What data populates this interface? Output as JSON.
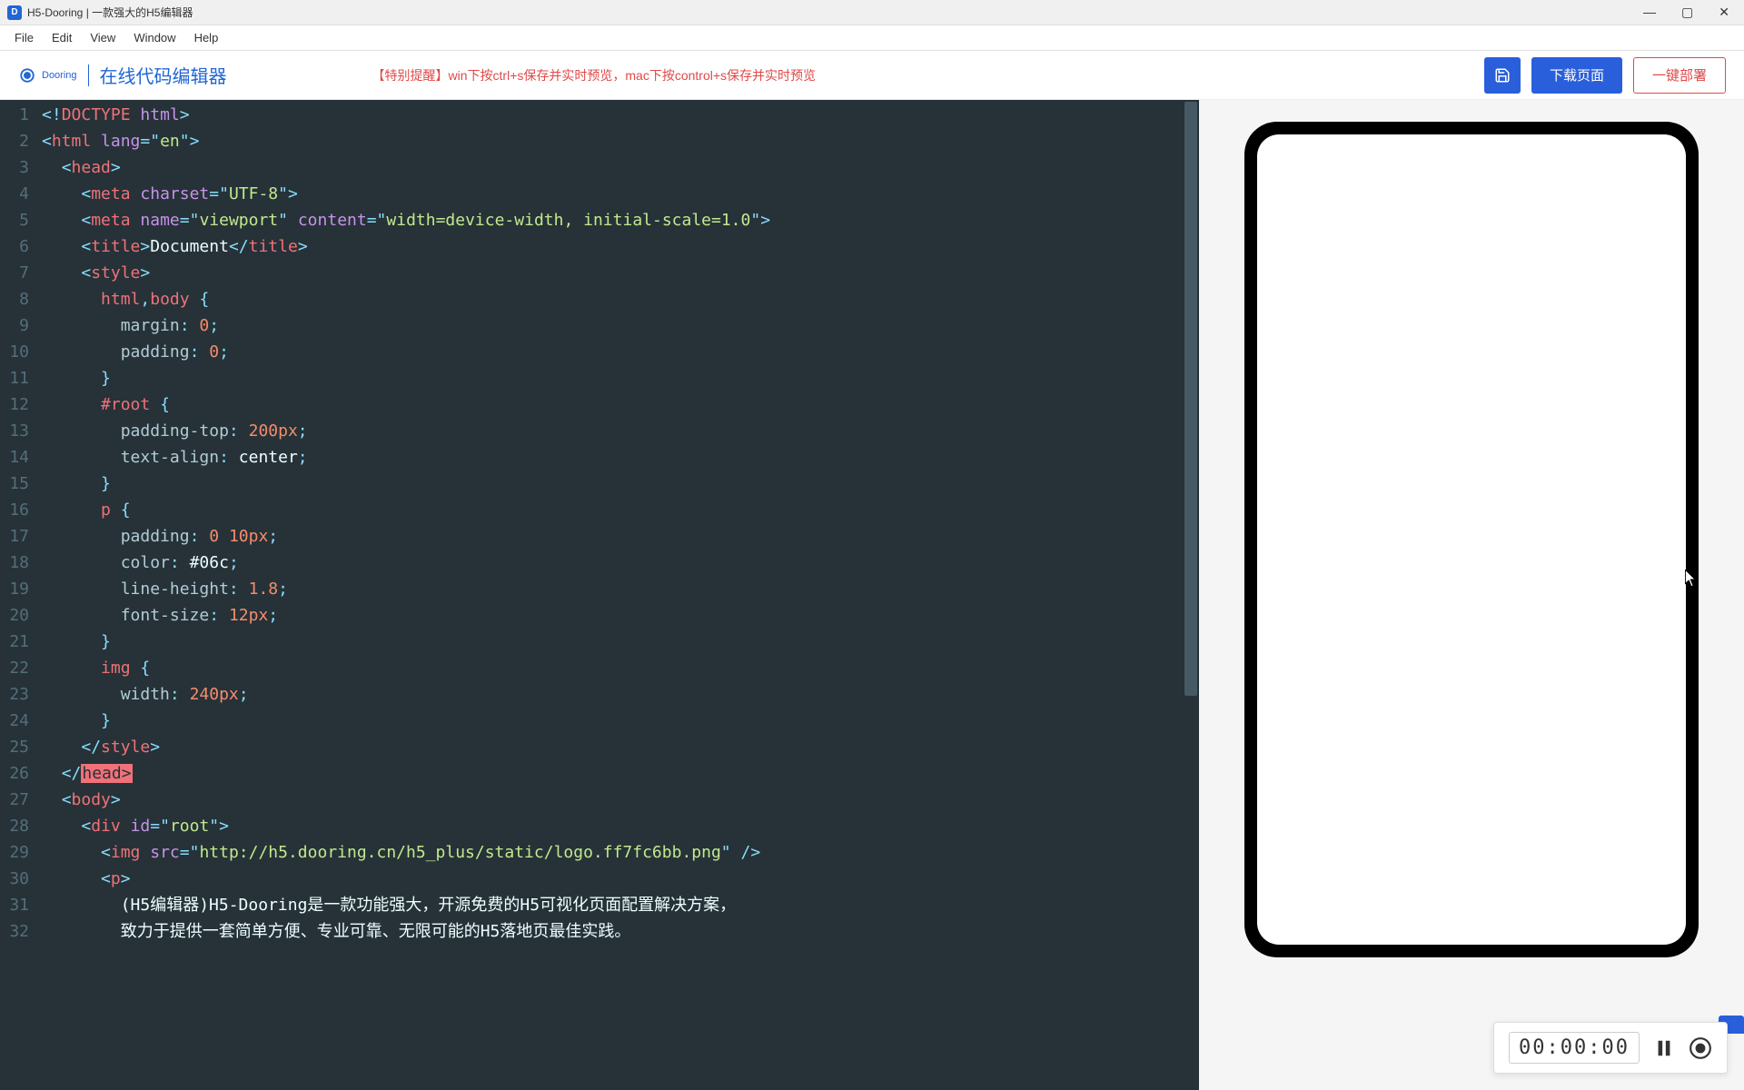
{
  "window": {
    "title": "H5-Dooring | 一款强大的H5编辑器"
  },
  "menu": {
    "file": "File",
    "edit": "Edit",
    "view": "View",
    "window": "Window",
    "help": "Help"
  },
  "toolbar": {
    "logo_text": "Dooring",
    "page_title": "在线代码编辑器",
    "tip_label": "【特别提醒】",
    "tip_text": "win下按ctrl+s保存并实时预览，mac下按control+s保存并实时预览",
    "download_label": "下载页面",
    "deploy_label": "一键部署"
  },
  "recorder": {
    "timer": "00:00:00"
  },
  "code": {
    "lines": [
      {
        "n": 1,
        "html": "<span class='c-punc'>&lt;!</span><span class='c-tag'>DOCTYPE</span> <span class='c-attr'>html</span><span class='c-punc'>&gt;</span>"
      },
      {
        "n": 2,
        "html": "<span class='c-punc'>&lt;</span><span class='c-tag'>html</span> <span class='c-attr'>lang</span><span class='c-punc'>=</span><span class='c-punc'>\"</span><span class='c-str'>en</span><span class='c-punc'>\"</span><span class='c-punc'>&gt;</span>"
      },
      {
        "n": 3,
        "html": "  <span class='c-punc'>&lt;</span><span class='c-tag'>head</span><span class='c-punc'>&gt;</span>"
      },
      {
        "n": 4,
        "html": "    <span class='c-punc'>&lt;</span><span class='c-tag'>meta</span> <span class='c-attr'>charset</span><span class='c-punc'>=</span><span class='c-punc'>\"</span><span class='c-str'>UTF-8</span><span class='c-punc'>\"</span><span class='c-punc'>&gt;</span>"
      },
      {
        "n": 5,
        "html": "    <span class='c-punc'>&lt;</span><span class='c-tag'>meta</span> <span class='c-attr'>name</span><span class='c-punc'>=</span><span class='c-punc'>\"</span><span class='c-str'>viewport</span><span class='c-punc'>\"</span> <span class='c-attr'>content</span><span class='c-punc'>=</span><span class='c-punc'>\"</span><span class='c-str'>width=device-width, initial-scale=1.0</span><span class='c-punc'>\"</span><span class='c-punc'>&gt;</span>"
      },
      {
        "n": 6,
        "html": "    <span class='c-punc'>&lt;</span><span class='c-tag'>title</span><span class='c-punc'>&gt;</span><span class='c-text'>Document</span><span class='c-punc'>&lt;/</span><span class='c-tag'>title</span><span class='c-punc'>&gt;</span>"
      },
      {
        "n": 7,
        "html": "    <span class='c-punc'>&lt;</span><span class='c-tag'>style</span><span class='c-punc'>&gt;</span>"
      },
      {
        "n": 8,
        "html": "      <span class='c-tag'>html</span><span class='c-punc'>,</span><span class='c-tag'>body</span> <span class='c-punc'>{</span>"
      },
      {
        "n": 9,
        "html": "        <span class='c-prop'>margin</span><span class='c-punc'>:</span> <span class='c-num'>0</span><span class='c-punc'>;</span>"
      },
      {
        "n": 10,
        "html": "        <span class='c-prop'>padding</span><span class='c-punc'>:</span> <span class='c-num'>0</span><span class='c-punc'>;</span>"
      },
      {
        "n": 11,
        "html": "      <span class='c-punc'>}</span>"
      },
      {
        "n": 12,
        "html": "      <span class='c-tag'>#root</span> <span class='c-punc'>{</span>"
      },
      {
        "n": 13,
        "html": "        <span class='c-prop'>padding-top</span><span class='c-punc'>:</span> <span class='c-num'>200px</span><span class='c-punc'>;</span>"
      },
      {
        "n": 14,
        "html": "        <span class='c-prop'>text-align</span><span class='c-punc'>:</span> <span class='c-text'>center</span><span class='c-punc'>;</span>"
      },
      {
        "n": 15,
        "html": "      <span class='c-punc'>}</span>"
      },
      {
        "n": 16,
        "html": "      <span class='c-tag'>p</span> <span class='c-punc'>{</span>"
      },
      {
        "n": 17,
        "html": "        <span class='c-prop'>padding</span><span class='c-punc'>:</span> <span class='c-num'>0</span> <span class='c-num'>10px</span><span class='c-punc'>;</span>"
      },
      {
        "n": 18,
        "html": "        <span class='c-prop'>color</span><span class='c-punc'>:</span> <span class='c-text'>#06c</span><span class='c-punc'>;</span>"
      },
      {
        "n": 19,
        "html": "        <span class='c-prop'>line-height</span><span class='c-punc'>:</span> <span class='c-num'>1.8</span><span class='c-punc'>;</span>"
      },
      {
        "n": 20,
        "html": "        <span class='c-prop'>font-size</span><span class='c-punc'>:</span> <span class='c-num'>12px</span><span class='c-punc'>;</span>"
      },
      {
        "n": 21,
        "html": "      <span class='c-punc'>}</span>"
      },
      {
        "n": 22,
        "html": "      <span class='c-tag'>img</span> <span class='c-punc'>{</span>"
      },
      {
        "n": 23,
        "html": "        <span class='c-prop'>width</span><span class='c-punc'>:</span> <span class='c-num'>240px</span><span class='c-punc'>;</span>"
      },
      {
        "n": 24,
        "html": "      <span class='c-punc'>}</span>"
      },
      {
        "n": 25,
        "html": "    <span class='c-punc'>&lt;/</span><span class='c-tag'>style</span><span class='c-punc'>&gt;</span>"
      },
      {
        "n": 26,
        "html": "  <span class='c-punc'>&lt;/</span><span class='hl'>head&gt;</span>"
      },
      {
        "n": 27,
        "html": "  <span class='c-punc'>&lt;</span><span class='c-tag'>body</span><span class='c-punc'>&gt;</span>"
      },
      {
        "n": 28,
        "html": "    <span class='c-punc'>&lt;</span><span class='c-tag'>div</span> <span class='c-attr'>id</span><span class='c-punc'>=</span><span class='c-punc'>\"</span><span class='c-str'>root</span><span class='c-punc'>\"</span><span class='c-punc'>&gt;</span>"
      },
      {
        "n": 29,
        "html": "      <span class='c-punc'>&lt;</span><span class='c-tag'>img</span> <span class='c-attr'>src</span><span class='c-punc'>=</span><span class='c-punc'>\"</span><span class='c-str'>http://h5.dooring.cn/h5_plus/static/logo.ff7fc6bb.png</span><span class='c-punc'>\"</span> <span class='c-punc'>/&gt;</span>"
      },
      {
        "n": 30,
        "html": "      <span class='c-punc'>&lt;</span><span class='c-tag'>p</span><span class='c-punc'>&gt;</span>"
      },
      {
        "n": 31,
        "html": "        <span class='c-text'>(H5编辑器)H5-Dooring是一款功能强大，开源免费的H5可视化页面配置解决方案，</span>"
      },
      {
        "n": 32,
        "html": "        <span class='c-text'>致力于提供一套简单方便、专业可靠、无限可能的H5落地页最佳实践。</span>"
      }
    ]
  }
}
